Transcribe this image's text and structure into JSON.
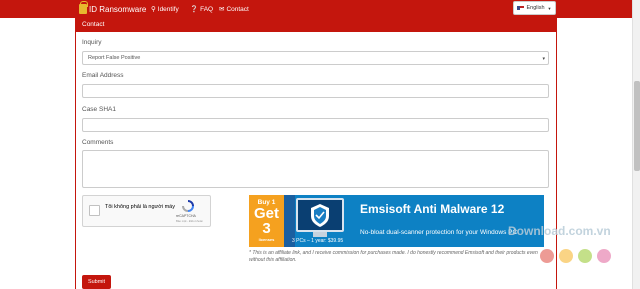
{
  "nav": {
    "brand": "ID Ransomware",
    "links": [
      {
        "icon": "🔍",
        "label": "Identify"
      },
      {
        "icon": "?",
        "label": "FAQ"
      },
      {
        "icon": "✉",
        "label": "Contact"
      }
    ],
    "language": "English"
  },
  "panel": {
    "title": "Contact"
  },
  "form": {
    "inquiry_label": "Inquiry",
    "inquiry_value": "Report False Positive",
    "email_label": "Email Address",
    "sha1_label": "Case SHA1",
    "comments_label": "Comments",
    "submit_label": "Submit"
  },
  "captcha": {
    "text": "Tôi không phải là người máy",
    "brand": "reCAPTCHA",
    "terms": "Bảo mật - Điều khoản"
  },
  "ad": {
    "offer_top": "Buy 1",
    "offer_main": "Get 3",
    "offer_bottom": "licenses",
    "title": "Emsisoft Anti Malware 12",
    "subtitle": "No-bloat dual-scanner protection for your Windows PC",
    "price": "3 PCs – 1 year: $39.95",
    "disclaimer": "* This is an affiliate link, and I receive commission for purchases made. I do honestly recommend Emsisoft and their products even without this affiliation."
  },
  "watermark": {
    "text": "Download.com.vn"
  },
  "colors": {
    "accent": "#c4160d",
    "ad_blue": "#0d81c4",
    "ad_orange": "#f5a11f"
  }
}
